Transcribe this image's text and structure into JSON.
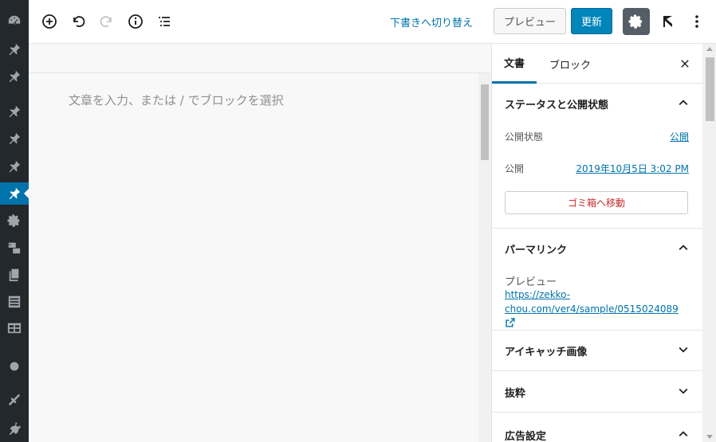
{
  "admin_menu": {
    "items": [
      {
        "icon": "dashboard-icon"
      },
      {
        "icon": "pin-icon"
      },
      {
        "icon": "pin-icon"
      },
      {
        "icon": "pin-icon"
      },
      {
        "icon": "pin-icon"
      },
      {
        "icon": "pin-icon"
      },
      {
        "icon": "pin-icon",
        "active": true
      },
      {
        "icon": "gear-icon"
      },
      {
        "icon": "media-icon"
      },
      {
        "icon": "pages-icon"
      },
      {
        "icon": "list-icon"
      },
      {
        "icon": "table-icon"
      },
      {
        "icon": "circle-icon"
      },
      {
        "icon": "tools-icon"
      },
      {
        "icon": "plugin-icon"
      }
    ]
  },
  "toolbar": {
    "save_draft_label": "下書きへ切り替え",
    "preview_label": "プレビュー",
    "update_label": "更新"
  },
  "editor": {
    "placeholder": "文章を入力、または / でブロックを選択"
  },
  "sidebar": {
    "tabs": [
      {
        "label": "文書",
        "active": true
      },
      {
        "label": "ブロック",
        "active": false
      }
    ],
    "status_panel": {
      "title": "ステータスと公開状態",
      "visibility_label": "公開状態",
      "visibility_value": "公開",
      "publish_label": "公開",
      "publish_value": "2019年10月5日 3:02 PM",
      "trash_label": "ゴミ箱へ移動"
    },
    "permalink_panel": {
      "title": "パーマリンク",
      "preview_label": "プレビュー",
      "url": "https://zekko-chou.com/ver4/sample/0515024089"
    },
    "featured_image_panel": {
      "title": "アイキャッチ画像"
    },
    "excerpt_panel": {
      "title": "抜粋"
    },
    "ad_settings_panel": {
      "title": "広告設定"
    }
  },
  "colors": {
    "admin_bg": "#23282d",
    "accent": "#0073aa",
    "update_button": "#0085ba",
    "trash_text": "#c92c2c"
  }
}
